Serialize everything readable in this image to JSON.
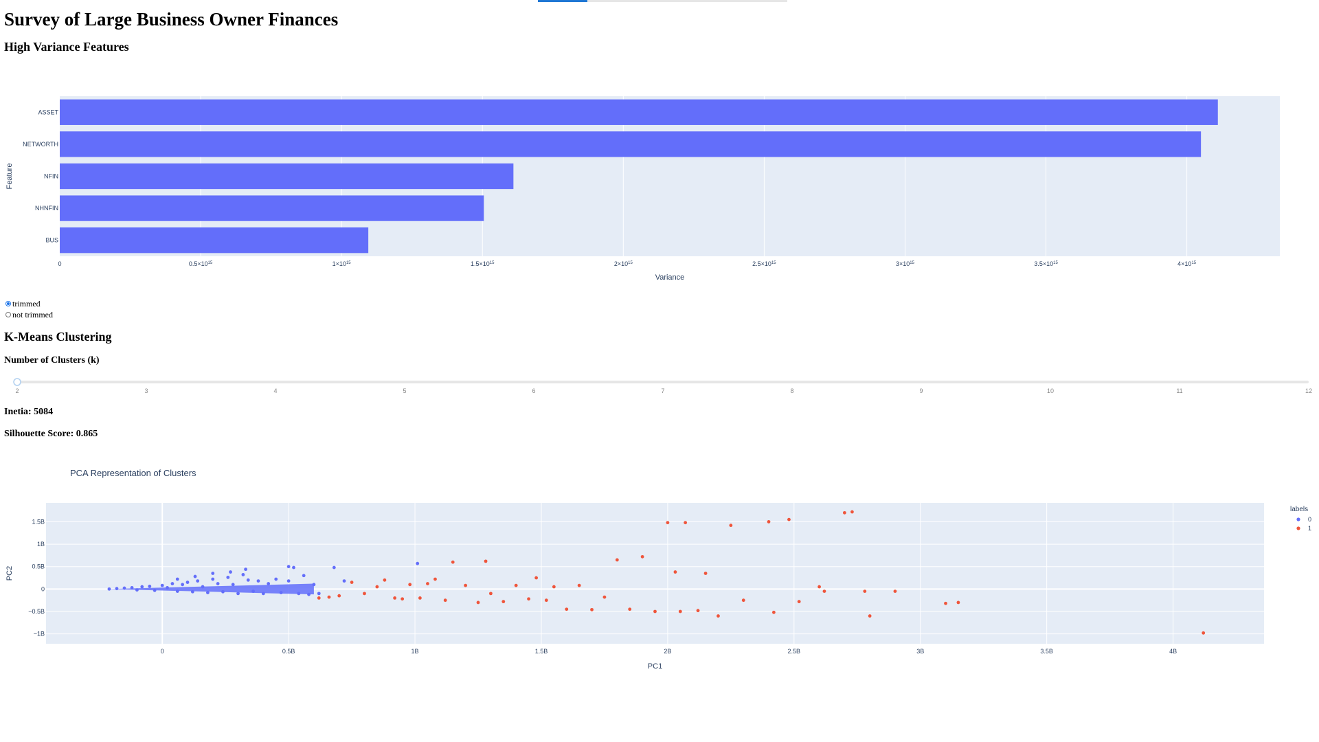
{
  "page": {
    "title": "Survey of Large Business Owner Finances",
    "variance_heading": "High Variance Features",
    "kmeans_heading": "K-Means Clustering",
    "k_label": "Number of Clusters (k)",
    "inertia_text": "Inetia: 5084",
    "silhouette_text": "Silhouette Score: 0.865"
  },
  "trim_options": [
    {
      "label": "trimmed",
      "checked": true
    },
    {
      "label": "not trimmed",
      "checked": false
    }
  ],
  "slider": {
    "min": 2,
    "max": 12,
    "value": 2,
    "marks": [
      "2",
      "3",
      "4",
      "5",
      "6",
      "7",
      "8",
      "9",
      "10",
      "11",
      "12"
    ]
  },
  "colors": {
    "bar": "#636efa",
    "cluster0": "#636efa",
    "cluster1": "#ef553b",
    "plot_bg": "#e5ecf6",
    "accent": "#1f77d4"
  },
  "chart_data": [
    {
      "type": "bar",
      "orientation": "horizontal",
      "categories": [
        "ASSET",
        "NETWORTH",
        "NFIN",
        "NHNFIN",
        "BUS"
      ],
      "values": [
        4110000000000000.0,
        4050000000000000.0,
        1610000000000000.0,
        1505000000000000.0,
        1095000000000000.0
      ],
      "title": "",
      "xlabel": "Variance",
      "ylabel": "Feature",
      "xlim": [
        0,
        4330000000000000.0
      ],
      "xticks": [
        {
          "v": 0,
          "m": "0",
          "e": ""
        },
        {
          "v": 500000000000000.0,
          "m": "0.5×10",
          "e": "15"
        },
        {
          "v": 1000000000000000.0,
          "m": "1×10",
          "e": "15"
        },
        {
          "v": 1500000000000000.0,
          "m": "1.5×10",
          "e": "15"
        },
        {
          "v": 2000000000000000.0,
          "m": "2×10",
          "e": "15"
        },
        {
          "v": 2500000000000000.0,
          "m": "2.5×10",
          "e": "15"
        },
        {
          "v": 3000000000000000.0,
          "m": "3×10",
          "e": "15"
        },
        {
          "v": 3500000000000000.0,
          "m": "3.5×10",
          "e": "15"
        },
        {
          "v": 4000000000000000.0,
          "m": "4×10",
          "e": "15"
        }
      ],
      "grid": true
    },
    {
      "type": "scatter",
      "title": "PCA Representation of Clusters",
      "xlabel": "PC1",
      "ylabel": "PC2",
      "xlim": [
        -0.46,
        4.36
      ],
      "ylim": [
        -1.22,
        1.92
      ],
      "unit": "billions",
      "xticks": [
        {
          "v": 0,
          "t": "0"
        },
        {
          "v": 0.5,
          "t": "0.5B"
        },
        {
          "v": 1,
          "t": "1B"
        },
        {
          "v": 1.5,
          "t": "1.5B"
        },
        {
          "v": 2,
          "t": "2B"
        },
        {
          "v": 2.5,
          "t": "2.5B"
        },
        {
          "v": 3,
          "t": "3B"
        },
        {
          "v": 3.5,
          "t": "3.5B"
        },
        {
          "v": 4,
          "t": "4B"
        }
      ],
      "yticks": [
        {
          "v": -1,
          "t": "−1B"
        },
        {
          "v": -0.5,
          "t": "−0.5B"
        },
        {
          "v": 0,
          "t": "0"
        },
        {
          "v": 0.5,
          "t": "0.5B"
        },
        {
          "v": 1,
          "t": "1B"
        },
        {
          "v": 1.5,
          "t": "1.5B"
        }
      ],
      "legend": {
        "title": "labels",
        "entries": [
          "0",
          "1"
        ],
        "placement": "top-right"
      },
      "grid": true,
      "series": [
        {
          "name": "0",
          "points": [
            [
              -0.21,
              0.0
            ],
            [
              -0.18,
              0.01
            ],
            [
              -0.15,
              0.02
            ],
            [
              -0.12,
              0.03
            ],
            [
              -0.1,
              -0.02
            ],
            [
              -0.08,
              0.05
            ],
            [
              -0.05,
              0.06
            ],
            [
              -0.03,
              -0.03
            ],
            [
              0.0,
              0.08
            ],
            [
              0.02,
              0.03
            ],
            [
              0.04,
              0.12
            ],
            [
              0.06,
              -0.05
            ],
            [
              0.08,
              0.1
            ],
            [
              0.1,
              0.15
            ],
            [
              0.12,
              -0.06
            ],
            [
              0.14,
              0.18
            ],
            [
              0.16,
              0.05
            ],
            [
              0.18,
              -0.08
            ],
            [
              0.2,
              0.22
            ],
            [
              0.22,
              0.12
            ],
            [
              0.24,
              -0.06
            ],
            [
              0.26,
              0.26
            ],
            [
              0.28,
              0.1
            ],
            [
              0.3,
              -0.1
            ],
            [
              0.32,
              0.32
            ],
            [
              0.34,
              0.2
            ],
            [
              0.36,
              -0.05
            ],
            [
              0.38,
              0.18
            ],
            [
              0.4,
              -0.1
            ],
            [
              0.42,
              0.12
            ],
            [
              0.45,
              0.22
            ],
            [
              0.47,
              -0.08
            ],
            [
              0.5,
              0.18
            ],
            [
              0.52,
              0.48
            ],
            [
              0.54,
              -0.1
            ],
            [
              0.56,
              0.3
            ],
            [
              0.58,
              -0.12
            ],
            [
              0.6,
              0.1
            ],
            [
              0.62,
              -0.1
            ],
            [
              0.06,
              0.22
            ],
            [
              0.13,
              0.28
            ],
            [
              0.2,
              0.35
            ],
            [
              0.27,
              0.38
            ],
            [
              0.33,
              0.44
            ],
            [
              0.5,
              0.5
            ],
            [
              0.68,
              0.48
            ],
            [
              0.72,
              0.18
            ],
            [
              1.01,
              0.57
            ]
          ]
        },
        {
          "name": "1",
          "points": [
            [
              0.62,
              -0.2
            ],
            [
              0.66,
              -0.18
            ],
            [
              0.7,
              -0.15
            ],
            [
              0.75,
              0.15
            ],
            [
              0.8,
              -0.1
            ],
            [
              0.85,
              0.05
            ],
            [
              0.88,
              0.2
            ],
            [
              0.92,
              -0.2
            ],
            [
              0.95,
              -0.22
            ],
            [
              0.98,
              0.1
            ],
            [
              1.02,
              -0.2
            ],
            [
              1.05,
              0.12
            ],
            [
              1.08,
              0.22
            ],
            [
              1.12,
              -0.25
            ],
            [
              1.15,
              0.6
            ],
            [
              1.2,
              0.08
            ],
            [
              1.25,
              -0.3
            ],
            [
              1.28,
              0.62
            ],
            [
              1.3,
              -0.1
            ],
            [
              1.35,
              -0.28
            ],
            [
              1.4,
              0.08
            ],
            [
              1.45,
              -0.22
            ],
            [
              1.48,
              0.25
            ],
            [
              1.52,
              -0.25
            ],
            [
              1.55,
              0.05
            ],
            [
              1.6,
              -0.45
            ],
            [
              1.65,
              0.08
            ],
            [
              1.7,
              -0.46
            ],
            [
              1.75,
              -0.18
            ],
            [
              1.8,
              0.65
            ],
            [
              1.85,
              -0.45
            ],
            [
              1.9,
              0.72
            ],
            [
              1.95,
              -0.5
            ],
            [
              2.0,
              1.48
            ],
            [
              2.03,
              0.38
            ],
            [
              2.05,
              -0.5
            ],
            [
              2.07,
              1.48
            ],
            [
              2.12,
              -0.48
            ],
            [
              2.15,
              0.35
            ],
            [
              2.2,
              -0.6
            ],
            [
              2.25,
              1.42
            ],
            [
              2.3,
              -0.25
            ],
            [
              2.4,
              1.5
            ],
            [
              2.42,
              -0.52
            ],
            [
              2.48,
              1.55
            ],
            [
              2.52,
              -0.28
            ],
            [
              2.6,
              0.05
            ],
            [
              2.62,
              -0.05
            ],
            [
              2.7,
              1.7
            ],
            [
              2.73,
              1.72
            ],
            [
              2.78,
              -0.05
            ],
            [
              2.8,
              -0.6
            ],
            [
              2.9,
              -0.05
            ],
            [
              3.1,
              -0.32
            ],
            [
              3.15,
              -0.3
            ],
            [
              4.12,
              -0.98
            ]
          ]
        }
      ]
    }
  ]
}
